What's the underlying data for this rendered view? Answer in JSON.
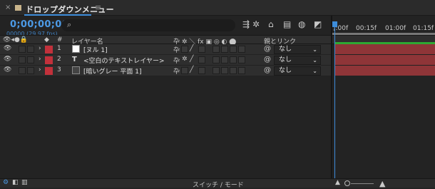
{
  "tab": {
    "close": "×",
    "title": "ドロップダウンメニュー",
    "menu": "≡"
  },
  "time": {
    "timecode": "0;00;00;00",
    "fps": "00000 (29.97 fps)"
  },
  "search": {
    "icon": "search-icon",
    "glyph": "⌕"
  },
  "header_icons": [
    {
      "name": "comp-flowchart-icon",
      "glyph": "⇶"
    },
    {
      "name": "draft-3d-icon",
      "glyph": "✲"
    },
    {
      "name": "shy-layers-icon",
      "glyph": "⌂"
    },
    {
      "name": "frame-blending-icon",
      "glyph": "▤"
    },
    {
      "name": "motion-blur-icon",
      "glyph": "◍"
    },
    {
      "name": "graph-editor-icon",
      "glyph": "◩"
    }
  ],
  "ruler": {
    "ticks": [
      "):00f",
      "00:15f",
      "01:00f",
      "01:15f"
    ]
  },
  "columns": {
    "layer_name": "レイヤー名",
    "number": "#",
    "parent": "親とリンク",
    "switch_icons": "卆 ✲ ＼ fx ▣ ◎ ◐ ⬤"
  },
  "layers": [
    {
      "num": "1",
      "type": "solid-white",
      "name": "[ヌル 1]",
      "parent": "なし",
      "icon_color": "#ffffff",
      "label_color": "#c2313b"
    },
    {
      "num": "2",
      "type": "text",
      "name": "<空白のテキストレイヤー>",
      "parent": "なし",
      "icon_glyph": "T",
      "label_color": "#c2313b"
    },
    {
      "num": "3",
      "type": "solid-dark",
      "name": "[暗いグレー 平面 1]",
      "parent": "なし",
      "icon_color": "#444444",
      "label_color": "#c2313b"
    }
  ],
  "parent_dropdown_arrow": "⌄",
  "pickwhip_glyph": "@",
  "bottom": {
    "label": "スイッチ / モード"
  },
  "colors": {
    "accent": "#3d8cd9",
    "layer_bar": "#8f3538",
    "workarea": "#2ea832"
  }
}
